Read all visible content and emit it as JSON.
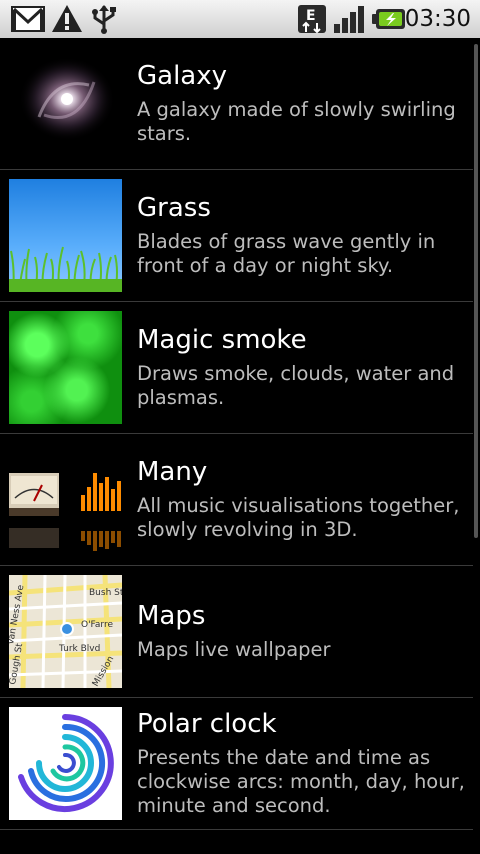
{
  "status_bar": {
    "icons": [
      "gmail-icon",
      "warning-icon",
      "usb-icon",
      "edge-data-icon",
      "signal-icon",
      "battery-charging-icon"
    ],
    "time": "03:30"
  },
  "wallpapers": [
    {
      "title": "Galaxy",
      "description": "A galaxy made of slowly swirling stars.",
      "thumbnail": "galaxy-thumbnail"
    },
    {
      "title": "Grass",
      "description": "Blades of grass wave gently in front of a day or night sky.",
      "thumbnail": "grass-thumbnail"
    },
    {
      "title": "Magic smoke",
      "description": "Draws smoke, clouds, water and plasmas.",
      "thumbnail": "smoke-thumbnail"
    },
    {
      "title": "Many",
      "description": "All music visualisations together, slowly revolving in 3D.",
      "thumbnail": "music-visualizer-thumbnail"
    },
    {
      "title": "Maps",
      "description": "Maps live wallpaper",
      "thumbnail": "map-thumbnail"
    },
    {
      "title": "Polar clock",
      "description": "Presents the date and time as clockwise arcs: month, day, hour, minute and second.",
      "thumbnail": "polar-clock-thumbnail"
    }
  ],
  "map_labels": {
    "street1": "Van Ness Ave",
    "street2": "Bush St",
    "street3": "O'Farre",
    "street4": "Turk Blvd",
    "street5": "Gough St",
    "street6": "Mission"
  }
}
